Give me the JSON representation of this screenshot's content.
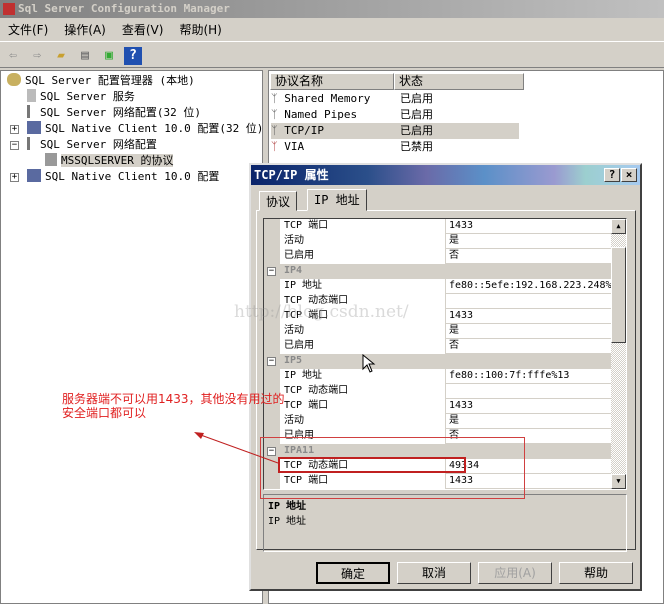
{
  "window": {
    "title": "Sql Server Configuration Manager"
  },
  "menu": [
    "文件(F)",
    "操作(A)",
    "查看(V)",
    "帮助(H)"
  ],
  "toolbar": {
    "icons": [
      "back-arrow-icon",
      "forward-arrow-icon",
      "up-folder-icon",
      "properties-icon",
      "export-icon",
      "help-icon"
    ],
    "help_glyph": "?"
  },
  "tree": [
    {
      "label": "SQL Server 配置管理器 (本地)",
      "icon": "config-manager-icon"
    },
    {
      "label": "SQL Server 服务",
      "icon": "server-icon"
    },
    {
      "label": "SQL Server 网络配置(32 位)",
      "icon": "network-icon"
    },
    {
      "label": "SQL Native Client 10.0 配置(32 位)",
      "icon": "client-icon",
      "toggle": "+"
    },
    {
      "label": "SQL Server 网络配置",
      "icon": "network-icon",
      "toggle": "−"
    },
    {
      "label": "MSSQLSERVER 的协议",
      "icon": "protocol-icon",
      "selected": true
    },
    {
      "label": "SQL Native Client 10.0 配置",
      "icon": "client-icon",
      "toggle": "+"
    }
  ],
  "list": {
    "headers": [
      "协议名称",
      "状态"
    ],
    "rows": [
      {
        "name": "Shared Memory",
        "status": "已启用"
      },
      {
        "name": "Named Pipes",
        "status": "已启用"
      },
      {
        "name": "TCP/IP",
        "status": "已启用"
      },
      {
        "name": "VIA",
        "status": "已禁用"
      }
    ]
  },
  "dialog": {
    "title": "TCP/IP 属性",
    "help_btn": "?",
    "close_btn": "×",
    "tabs": [
      "协议",
      "IP 地址"
    ],
    "grid": [
      {
        "k": "TCP 端口",
        "v": "1433"
      },
      {
        "k": "活动",
        "v": "是"
      },
      {
        "k": "已启用",
        "v": "否"
      },
      {
        "cat": "IP4"
      },
      {
        "k": "IP 地址",
        "v": "fe80::5efe:192.168.223.248%"
      },
      {
        "k": "TCP 动态端口",
        "v": ""
      },
      {
        "k": "TCP 端口",
        "v": "1433"
      },
      {
        "k": "活动",
        "v": "是"
      },
      {
        "k": "已启用",
        "v": "否"
      },
      {
        "cat": "IP5"
      },
      {
        "k": "IP 地址",
        "v": "fe80::100:7f:fffe%13"
      },
      {
        "k": "TCP 动态端口",
        "v": ""
      },
      {
        "k": "TCP 端口",
        "v": "1433"
      },
      {
        "k": "活动",
        "v": "是"
      },
      {
        "k": "已启用",
        "v": "否"
      },
      {
        "cat": "IPA11"
      },
      {
        "k": "TCP 动态端口",
        "v": "49334"
      },
      {
        "k": "TCP 端口",
        "v": "1433"
      }
    ],
    "desc_title": "IP 地址",
    "desc_text": "IP 地址",
    "buttons": [
      "确定",
      "取消",
      "应用(A)",
      "帮助"
    ]
  },
  "annotation": {
    "text": "服务器端不可以用1433，其他没有用过的安全端口都可以",
    "color": "#e02020"
  },
  "watermark": "http://blog.csdn.net/"
}
